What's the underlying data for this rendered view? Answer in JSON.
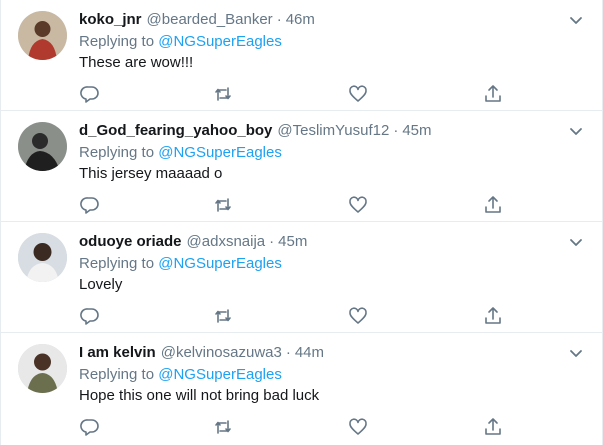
{
  "replies": [
    {
      "name": "koko_jnr",
      "handle": "@bearded_Banker",
      "time": "46m",
      "replying_prefix": "Replying to",
      "replying_to": "@NGSuperEagles",
      "text": "These are wow!!!",
      "avatar_icon": "avatar-photo-icon",
      "avatar_colors": {
        "bg": "#c9b9a2",
        "fg": "#b03a2e"
      }
    },
    {
      "name": "d_God_fearing_yahoo_boy",
      "handle": "@TeslimYusuf12",
      "time": "45m",
      "replying_prefix": "Replying to",
      "replying_to": "@NGSuperEagles",
      "text": "This jersey maaaad o",
      "avatar_icon": "avatar-photo-icon",
      "avatar_colors": {
        "bg": "#8a8f8a",
        "fg": "#2b2b2b"
      }
    },
    {
      "name": "oduoye oriade",
      "handle": "@adxsnaija",
      "time": "45m",
      "replying_prefix": "Replying to",
      "replying_to": "@NGSuperEagles",
      "text": "Lovely",
      "avatar_icon": "avatar-photo-icon",
      "avatar_colors": {
        "bg": "#d7dde3",
        "fg": "#3b2a22"
      }
    },
    {
      "name": "I am kelvin",
      "handle": "@kelvinosazuwa3",
      "time": "44m",
      "replying_prefix": "Replying to",
      "replying_to": "@NGSuperEagles",
      "text": "Hope this one will not bring bad luck",
      "avatar_icon": "avatar-photo-icon",
      "avatar_colors": {
        "bg": "#e8e8e8",
        "fg": "#4a3326"
      }
    }
  ],
  "separator": "·",
  "colors": {
    "accent": "#1da1f2",
    "secondary_text": "#657786",
    "primary_text": "#14171a",
    "border": "#e6ecf0"
  },
  "action_icons": [
    "reply-icon",
    "retweet-icon",
    "like-icon",
    "share-icon"
  ],
  "menu_icon": "chevron-down-icon"
}
